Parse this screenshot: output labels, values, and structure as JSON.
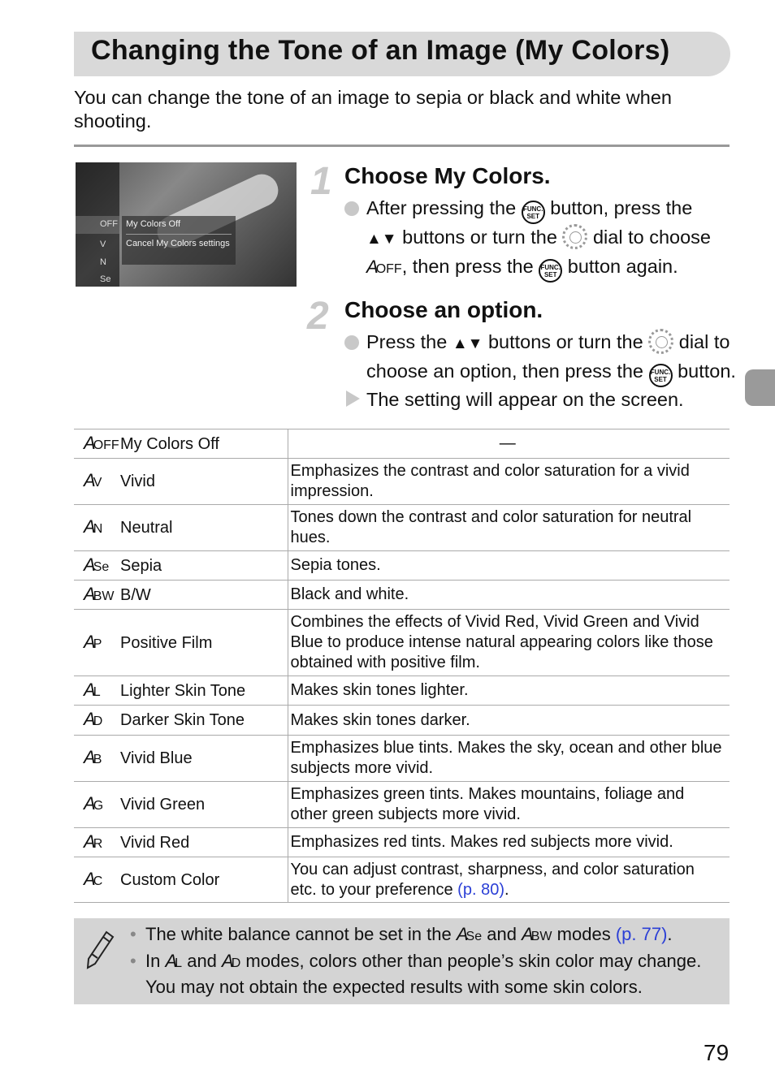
{
  "title": "Changing the Tone of an Image (My Colors)",
  "intro": "You can change the tone of an image to sepia or black and white when shooting.",
  "screen": {
    "item_label": "My Colors Off",
    "item_desc": "Cancel My Colors settings",
    "menu_icons": [
      "OFF",
      "V",
      "N",
      "Se"
    ]
  },
  "steps": [
    {
      "number": "1",
      "heading": "Choose My Colors.",
      "t1": "After pressing the",
      "t2": "button, press the",
      "t3": "buttons or turn the",
      "t4": "dial to choose",
      "t5": ", then press the",
      "t6": "button again."
    },
    {
      "number": "2",
      "heading": "Choose an option.",
      "t1": "Press the",
      "t2": "buttons or turn the",
      "t3": "dial to",
      "t4": "choose an option, then press the",
      "t5": "button.",
      "result": "The setting will appear on the screen."
    }
  ],
  "func_label": "FUNC. SET",
  "arrows": "▲▼",
  "table": [
    {
      "icon": "my-colors-off-icon",
      "suffix": "OFF",
      "name": "My Colors Off",
      "desc": "—"
    },
    {
      "icon": "vivid-icon",
      "suffix": "V",
      "name": "Vivid",
      "desc": "Emphasizes the contrast and color saturation for a vivid impression."
    },
    {
      "icon": "neutral-icon",
      "suffix": "N",
      "name": "Neutral",
      "desc": "Tones down the contrast and color saturation for neutral hues."
    },
    {
      "icon": "sepia-icon",
      "suffix": "Se",
      "name": "Sepia",
      "desc": "Sepia tones."
    },
    {
      "icon": "bw-icon",
      "suffix": "BW",
      "name": "B/W",
      "desc": "Black and white."
    },
    {
      "icon": "positive-film-icon",
      "suffix": "P",
      "name": "Positive Film",
      "desc": "Combines the effects of Vivid Red, Vivid Green and Vivid Blue to produce intense natural appearing colors like those obtained with positive film."
    },
    {
      "icon": "lighter-skin-icon",
      "suffix": "L",
      "name": "Lighter Skin Tone",
      "desc": "Makes skin tones lighter."
    },
    {
      "icon": "darker-skin-icon",
      "suffix": "D",
      "name": "Darker Skin Tone",
      "desc": "Makes skin tones darker."
    },
    {
      "icon": "vivid-blue-icon",
      "suffix": "B",
      "name": "Vivid Blue",
      "desc": "Emphasizes blue tints. Makes the sky, ocean and other blue subjects more vivid."
    },
    {
      "icon": "vivid-green-icon",
      "suffix": "G",
      "name": "Vivid Green",
      "desc": "Emphasizes green tints. Makes mountains, foliage and other green subjects more vivid."
    },
    {
      "icon": "vivid-red-icon",
      "suffix": "R",
      "name": "Vivid Red",
      "desc": "Emphasizes red tints. Makes red subjects more vivid."
    },
    {
      "icon": "custom-color-icon",
      "suffix": "C",
      "name": "Custom Color",
      "desc": "You can adjust contrast, sharpness, and color saturation etc. to your preference",
      "link": "(p. 80)",
      "end": "."
    }
  ],
  "notes": {
    "n1a": "The white balance cannot be set in the",
    "n1b": "and",
    "n1c": "modes",
    "n1link": "(p. 77)",
    "n1end": ".",
    "n2a": "In",
    "n2b": "and",
    "n2c": "modes, colors other than people’s skin color may change. You may not obtain the expected results with some skin colors."
  },
  "page_number": "79",
  "colors": {
    "title_bg": "#d9d9d9",
    "note_bg": "#d4d4d4",
    "link": "#2b3fd6",
    "side_tab": "#9a9a9a"
  }
}
